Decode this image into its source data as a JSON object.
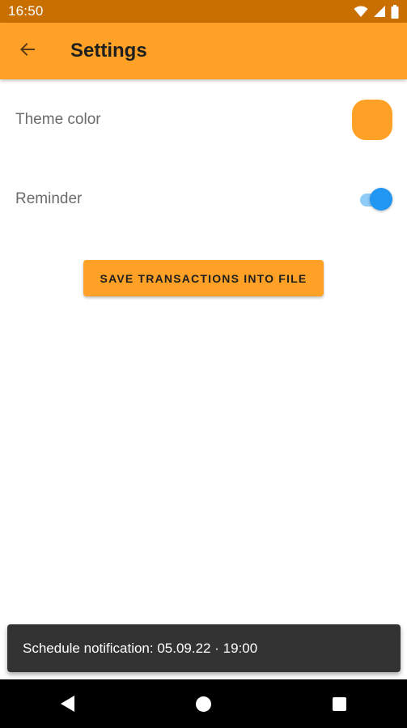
{
  "status_bar": {
    "time": "16:50",
    "icons": [
      "wifi-icon",
      "signal-icon",
      "battery-icon"
    ]
  },
  "app_bar": {
    "back_icon": "arrow-left-icon",
    "title": "Settings"
  },
  "settings": {
    "theme_color": {
      "label": "Theme color",
      "value_color": "#ffa126"
    },
    "reminder": {
      "label": "Reminder",
      "enabled": true
    }
  },
  "save_button": {
    "label": "SAVE TRANSACTIONS INTO FILE"
  },
  "snackbar": {
    "message": "Schedule notification: 05.09.22 · 19:00"
  },
  "nav_bar": {
    "buttons": [
      "back-triangle-icon",
      "home-circle-icon",
      "recents-square-icon"
    ]
  },
  "colors": {
    "status_bar": "#c86f00",
    "accent": "#ffa126",
    "switch_on": "#2196f3",
    "snackbar_bg": "#333333"
  }
}
